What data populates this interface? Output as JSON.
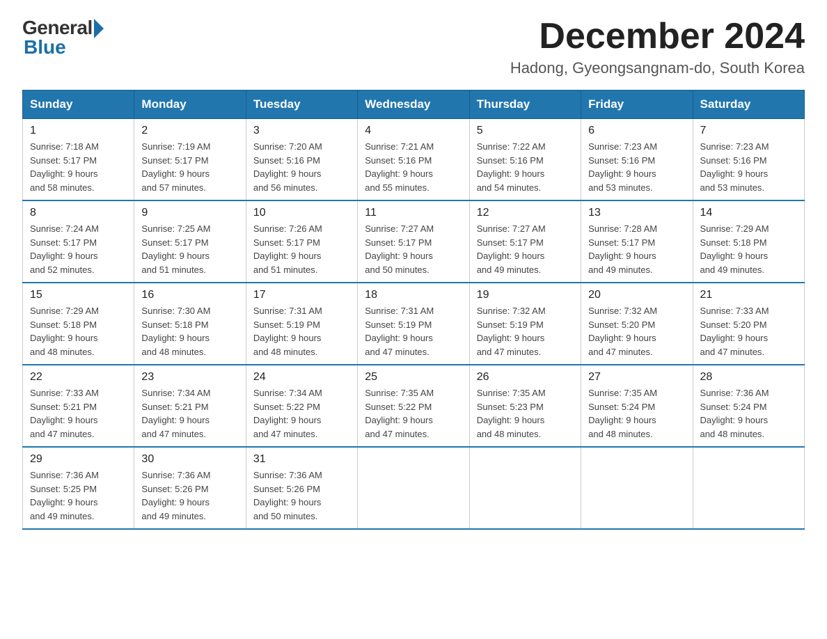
{
  "logo": {
    "general": "General",
    "blue": "Blue"
  },
  "title": "December 2024",
  "subtitle": "Hadong, Gyeongsangnam-do, South Korea",
  "days_of_week": [
    "Sunday",
    "Monday",
    "Tuesday",
    "Wednesday",
    "Thursday",
    "Friday",
    "Saturday"
  ],
  "weeks": [
    [
      {
        "day": "1",
        "sunrise": "7:18 AM",
        "sunset": "5:17 PM",
        "daylight": "9 hours and 58 minutes."
      },
      {
        "day": "2",
        "sunrise": "7:19 AM",
        "sunset": "5:17 PM",
        "daylight": "9 hours and 57 minutes."
      },
      {
        "day": "3",
        "sunrise": "7:20 AM",
        "sunset": "5:16 PM",
        "daylight": "9 hours and 56 minutes."
      },
      {
        "day": "4",
        "sunrise": "7:21 AM",
        "sunset": "5:16 PM",
        "daylight": "9 hours and 55 minutes."
      },
      {
        "day": "5",
        "sunrise": "7:22 AM",
        "sunset": "5:16 PM",
        "daylight": "9 hours and 54 minutes."
      },
      {
        "day": "6",
        "sunrise": "7:23 AM",
        "sunset": "5:16 PM",
        "daylight": "9 hours and 53 minutes."
      },
      {
        "day": "7",
        "sunrise": "7:23 AM",
        "sunset": "5:16 PM",
        "daylight": "9 hours and 53 minutes."
      }
    ],
    [
      {
        "day": "8",
        "sunrise": "7:24 AM",
        "sunset": "5:17 PM",
        "daylight": "9 hours and 52 minutes."
      },
      {
        "day": "9",
        "sunrise": "7:25 AM",
        "sunset": "5:17 PM",
        "daylight": "9 hours and 51 minutes."
      },
      {
        "day": "10",
        "sunrise": "7:26 AM",
        "sunset": "5:17 PM",
        "daylight": "9 hours and 51 minutes."
      },
      {
        "day": "11",
        "sunrise": "7:27 AM",
        "sunset": "5:17 PM",
        "daylight": "9 hours and 50 minutes."
      },
      {
        "day": "12",
        "sunrise": "7:27 AM",
        "sunset": "5:17 PM",
        "daylight": "9 hours and 49 minutes."
      },
      {
        "day": "13",
        "sunrise": "7:28 AM",
        "sunset": "5:17 PM",
        "daylight": "9 hours and 49 minutes."
      },
      {
        "day": "14",
        "sunrise": "7:29 AM",
        "sunset": "5:18 PM",
        "daylight": "9 hours and 49 minutes."
      }
    ],
    [
      {
        "day": "15",
        "sunrise": "7:29 AM",
        "sunset": "5:18 PM",
        "daylight": "9 hours and 48 minutes."
      },
      {
        "day": "16",
        "sunrise": "7:30 AM",
        "sunset": "5:18 PM",
        "daylight": "9 hours and 48 minutes."
      },
      {
        "day": "17",
        "sunrise": "7:31 AM",
        "sunset": "5:19 PM",
        "daylight": "9 hours and 48 minutes."
      },
      {
        "day": "18",
        "sunrise": "7:31 AM",
        "sunset": "5:19 PM",
        "daylight": "9 hours and 47 minutes."
      },
      {
        "day": "19",
        "sunrise": "7:32 AM",
        "sunset": "5:19 PM",
        "daylight": "9 hours and 47 minutes."
      },
      {
        "day": "20",
        "sunrise": "7:32 AM",
        "sunset": "5:20 PM",
        "daylight": "9 hours and 47 minutes."
      },
      {
        "day": "21",
        "sunrise": "7:33 AM",
        "sunset": "5:20 PM",
        "daylight": "9 hours and 47 minutes."
      }
    ],
    [
      {
        "day": "22",
        "sunrise": "7:33 AM",
        "sunset": "5:21 PM",
        "daylight": "9 hours and 47 minutes."
      },
      {
        "day": "23",
        "sunrise": "7:34 AM",
        "sunset": "5:21 PM",
        "daylight": "9 hours and 47 minutes."
      },
      {
        "day": "24",
        "sunrise": "7:34 AM",
        "sunset": "5:22 PM",
        "daylight": "9 hours and 47 minutes."
      },
      {
        "day": "25",
        "sunrise": "7:35 AM",
        "sunset": "5:22 PM",
        "daylight": "9 hours and 47 minutes."
      },
      {
        "day": "26",
        "sunrise": "7:35 AM",
        "sunset": "5:23 PM",
        "daylight": "9 hours and 48 minutes."
      },
      {
        "day": "27",
        "sunrise": "7:35 AM",
        "sunset": "5:24 PM",
        "daylight": "9 hours and 48 minutes."
      },
      {
        "day": "28",
        "sunrise": "7:36 AM",
        "sunset": "5:24 PM",
        "daylight": "9 hours and 48 minutes."
      }
    ],
    [
      {
        "day": "29",
        "sunrise": "7:36 AM",
        "sunset": "5:25 PM",
        "daylight": "9 hours and 49 minutes."
      },
      {
        "day": "30",
        "sunrise": "7:36 AM",
        "sunset": "5:26 PM",
        "daylight": "9 hours and 49 minutes."
      },
      {
        "day": "31",
        "sunrise": "7:36 AM",
        "sunset": "5:26 PM",
        "daylight": "9 hours and 50 minutes."
      },
      null,
      null,
      null,
      null
    ]
  ],
  "labels": {
    "sunrise": "Sunrise:",
    "sunset": "Sunset:",
    "daylight": "Daylight:"
  }
}
